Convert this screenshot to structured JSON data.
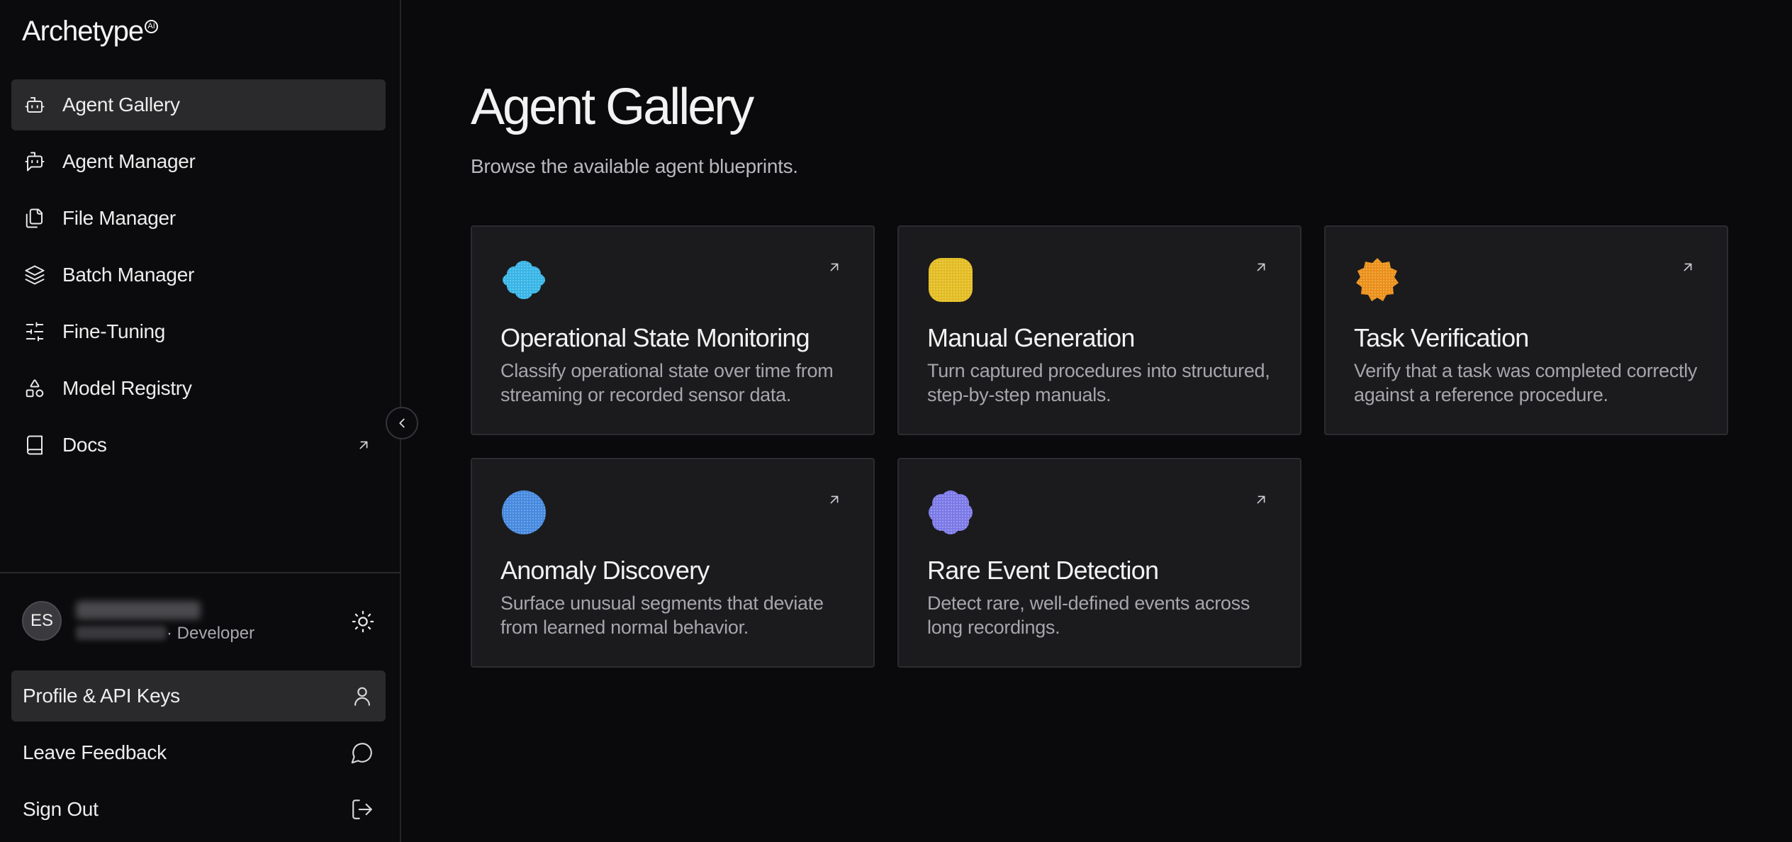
{
  "app": {
    "logo": "Archetype",
    "logo_mark": "AI"
  },
  "sidebar": {
    "items": [
      {
        "label": "Agent Gallery",
        "icon": "bot-icon",
        "active": true
      },
      {
        "label": "Agent Manager",
        "icon": "bot-message-icon"
      },
      {
        "label": "File Manager",
        "icon": "files-icon"
      },
      {
        "label": "Batch Manager",
        "icon": "layers-icon"
      },
      {
        "label": "Fine-Tuning",
        "icon": "sliders-icon"
      },
      {
        "label": "Model Registry",
        "icon": "shapes-icon"
      },
      {
        "label": "Docs",
        "icon": "book-icon",
        "external": true
      }
    ],
    "user": {
      "initials": "ES",
      "role": "· Developer"
    },
    "bottom_items": [
      {
        "label": "Profile & API Keys",
        "icon": "user-icon",
        "active": true
      },
      {
        "label": "Leave Feedback",
        "icon": "message-circle-icon"
      },
      {
        "label": "Sign Out",
        "icon": "log-out-icon"
      }
    ]
  },
  "main": {
    "title": "Agent Gallery",
    "subtitle": "Browse the available agent blueprints.",
    "cards": [
      {
        "title": "Operational State Monitoring",
        "description": "Classify operational state over time from streaming or recorded sensor data.",
        "icon": "cloud-blob-icon",
        "color": "#39b4e6"
      },
      {
        "title": "Manual Generation",
        "description": "Turn captured procedures into structured, step-by-step manuals.",
        "icon": "squircle-icon",
        "color": "#e6c02a"
      },
      {
        "title": "Task Verification",
        "description": "Verify that a task was completed correctly against a reference procedure.",
        "icon": "badge-icon",
        "color": "#ee9420"
      },
      {
        "title": "Anomaly Discovery",
        "description": "Surface unusual segments that deviate from learned normal behavior.",
        "icon": "circle-icon",
        "color": "#4a8fe0"
      },
      {
        "title": "Rare Event Detection",
        "description": "Detect rare, well-defined events across long recordings.",
        "icon": "flower-icon",
        "color": "#7f7ee8"
      }
    ]
  }
}
